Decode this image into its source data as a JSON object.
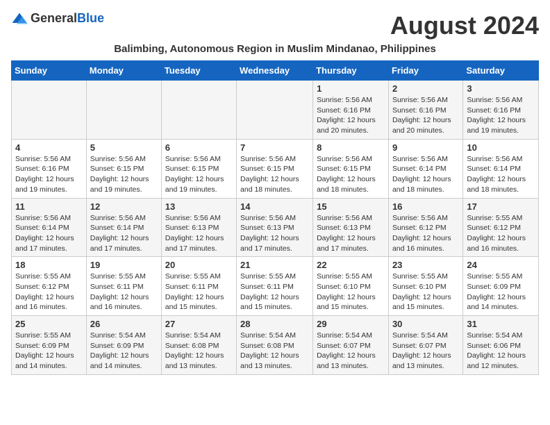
{
  "header": {
    "logo": {
      "general": "General",
      "blue": "Blue"
    },
    "title": "August 2024",
    "location": "Balimbing, Autonomous Region in Muslim Mindanao, Philippines"
  },
  "columns": [
    "Sunday",
    "Monday",
    "Tuesday",
    "Wednesday",
    "Thursday",
    "Friday",
    "Saturday"
  ],
  "weeks": [
    [
      {
        "day": "",
        "detail": ""
      },
      {
        "day": "",
        "detail": ""
      },
      {
        "day": "",
        "detail": ""
      },
      {
        "day": "",
        "detail": ""
      },
      {
        "day": "1",
        "detail": "Sunrise: 5:56 AM\nSunset: 6:16 PM\nDaylight: 12 hours and 20 minutes."
      },
      {
        "day": "2",
        "detail": "Sunrise: 5:56 AM\nSunset: 6:16 PM\nDaylight: 12 hours and 20 minutes."
      },
      {
        "day": "3",
        "detail": "Sunrise: 5:56 AM\nSunset: 6:16 PM\nDaylight: 12 hours and 19 minutes."
      }
    ],
    [
      {
        "day": "4",
        "detail": "Sunrise: 5:56 AM\nSunset: 6:16 PM\nDaylight: 12 hours and 19 minutes."
      },
      {
        "day": "5",
        "detail": "Sunrise: 5:56 AM\nSunset: 6:15 PM\nDaylight: 12 hours and 19 minutes."
      },
      {
        "day": "6",
        "detail": "Sunrise: 5:56 AM\nSunset: 6:15 PM\nDaylight: 12 hours and 19 minutes."
      },
      {
        "day": "7",
        "detail": "Sunrise: 5:56 AM\nSunset: 6:15 PM\nDaylight: 12 hours and 18 minutes."
      },
      {
        "day": "8",
        "detail": "Sunrise: 5:56 AM\nSunset: 6:15 PM\nDaylight: 12 hours and 18 minutes."
      },
      {
        "day": "9",
        "detail": "Sunrise: 5:56 AM\nSunset: 6:14 PM\nDaylight: 12 hours and 18 minutes."
      },
      {
        "day": "10",
        "detail": "Sunrise: 5:56 AM\nSunset: 6:14 PM\nDaylight: 12 hours and 18 minutes."
      }
    ],
    [
      {
        "day": "11",
        "detail": "Sunrise: 5:56 AM\nSunset: 6:14 PM\nDaylight: 12 hours and 17 minutes."
      },
      {
        "day": "12",
        "detail": "Sunrise: 5:56 AM\nSunset: 6:14 PM\nDaylight: 12 hours and 17 minutes."
      },
      {
        "day": "13",
        "detail": "Sunrise: 5:56 AM\nSunset: 6:13 PM\nDaylight: 12 hours and 17 minutes."
      },
      {
        "day": "14",
        "detail": "Sunrise: 5:56 AM\nSunset: 6:13 PM\nDaylight: 12 hours and 17 minutes."
      },
      {
        "day": "15",
        "detail": "Sunrise: 5:56 AM\nSunset: 6:13 PM\nDaylight: 12 hours and 17 minutes."
      },
      {
        "day": "16",
        "detail": "Sunrise: 5:56 AM\nSunset: 6:12 PM\nDaylight: 12 hours and 16 minutes."
      },
      {
        "day": "17",
        "detail": "Sunrise: 5:55 AM\nSunset: 6:12 PM\nDaylight: 12 hours and 16 minutes."
      }
    ],
    [
      {
        "day": "18",
        "detail": "Sunrise: 5:55 AM\nSunset: 6:12 PM\nDaylight: 12 hours and 16 minutes."
      },
      {
        "day": "19",
        "detail": "Sunrise: 5:55 AM\nSunset: 6:11 PM\nDaylight: 12 hours and 16 minutes."
      },
      {
        "day": "20",
        "detail": "Sunrise: 5:55 AM\nSunset: 6:11 PM\nDaylight: 12 hours and 15 minutes."
      },
      {
        "day": "21",
        "detail": "Sunrise: 5:55 AM\nSunset: 6:11 PM\nDaylight: 12 hours and 15 minutes."
      },
      {
        "day": "22",
        "detail": "Sunrise: 5:55 AM\nSunset: 6:10 PM\nDaylight: 12 hours and 15 minutes."
      },
      {
        "day": "23",
        "detail": "Sunrise: 5:55 AM\nSunset: 6:10 PM\nDaylight: 12 hours and 15 minutes."
      },
      {
        "day": "24",
        "detail": "Sunrise: 5:55 AM\nSunset: 6:09 PM\nDaylight: 12 hours and 14 minutes."
      }
    ],
    [
      {
        "day": "25",
        "detail": "Sunrise: 5:55 AM\nSunset: 6:09 PM\nDaylight: 12 hours and 14 minutes."
      },
      {
        "day": "26",
        "detail": "Sunrise: 5:54 AM\nSunset: 6:09 PM\nDaylight: 12 hours and 14 minutes."
      },
      {
        "day": "27",
        "detail": "Sunrise: 5:54 AM\nSunset: 6:08 PM\nDaylight: 12 hours and 13 minutes."
      },
      {
        "day": "28",
        "detail": "Sunrise: 5:54 AM\nSunset: 6:08 PM\nDaylight: 12 hours and 13 minutes."
      },
      {
        "day": "29",
        "detail": "Sunrise: 5:54 AM\nSunset: 6:07 PM\nDaylight: 12 hours and 13 minutes."
      },
      {
        "day": "30",
        "detail": "Sunrise: 5:54 AM\nSunset: 6:07 PM\nDaylight: 12 hours and 13 minutes."
      },
      {
        "day": "31",
        "detail": "Sunrise: 5:54 AM\nSunset: 6:06 PM\nDaylight: 12 hours and 12 minutes."
      }
    ]
  ]
}
